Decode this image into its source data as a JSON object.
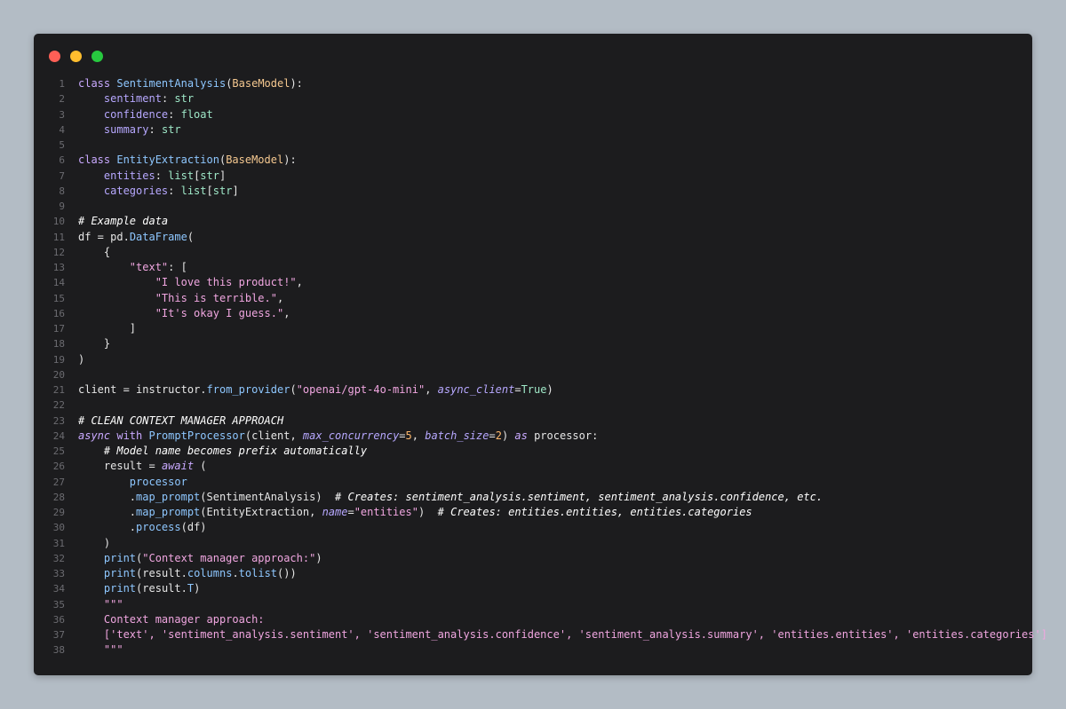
{
  "window": {
    "controls": [
      "close",
      "minimize",
      "maximize"
    ],
    "colors": {
      "background": "#1c1c1e",
      "close": "#ff5f56",
      "minimize": "#ffbd2e",
      "maximize": "#27c93f"
    }
  },
  "code": {
    "lines": [
      {
        "n": "1",
        "text": "class SentimentAnalysis(BaseModel):"
      },
      {
        "n": "2",
        "text": "    sentiment: str"
      },
      {
        "n": "3",
        "text": "    confidence: float"
      },
      {
        "n": "4",
        "text": "    summary: str"
      },
      {
        "n": "5",
        "text": ""
      },
      {
        "n": "6",
        "text": "class EntityExtraction(BaseModel):"
      },
      {
        "n": "7",
        "text": "    entities: list[str]"
      },
      {
        "n": "8",
        "text": "    categories: list[str]"
      },
      {
        "n": "9",
        "text": ""
      },
      {
        "n": "10",
        "text": "# Example data"
      },
      {
        "n": "11",
        "text": "df = pd.DataFrame("
      },
      {
        "n": "12",
        "text": "    {"
      },
      {
        "n": "13",
        "text": "        \"text\": ["
      },
      {
        "n": "14",
        "text": "            \"I love this product!\","
      },
      {
        "n": "15",
        "text": "            \"This is terrible.\","
      },
      {
        "n": "16",
        "text": "            \"It's okay I guess.\","
      },
      {
        "n": "17",
        "text": "        ]"
      },
      {
        "n": "18",
        "text": "    }"
      },
      {
        "n": "19",
        "text": ")"
      },
      {
        "n": "20",
        "text": ""
      },
      {
        "n": "21",
        "text": "client = instructor.from_provider(\"openai/gpt-4o-mini\", async_client=True)"
      },
      {
        "n": "22",
        "text": ""
      },
      {
        "n": "23",
        "text": "# CLEAN CONTEXT MANAGER APPROACH"
      },
      {
        "n": "24",
        "text": "async with PromptProcessor(client, max_concurrency=5, batch_size=2) as processor:"
      },
      {
        "n": "25",
        "text": "    # Model name becomes prefix automatically"
      },
      {
        "n": "26",
        "text": "    result = await ("
      },
      {
        "n": "27",
        "text": "        processor"
      },
      {
        "n": "28",
        "text": "        .map_prompt(SentimentAnalysis)  # Creates: sentiment_analysis.sentiment, sentiment_analysis.confidence, etc."
      },
      {
        "n": "29",
        "text": "        .map_prompt(EntityExtraction, name=\"entities\")  # Creates: entities.entities, entities.categories"
      },
      {
        "n": "30",
        "text": "        .process(df)"
      },
      {
        "n": "31",
        "text": "    )"
      },
      {
        "n": "32",
        "text": "    print(\"Context manager approach:\")"
      },
      {
        "n": "33",
        "text": "    print(result.columns.tolist())"
      },
      {
        "n": "34",
        "text": "    print(result.T)"
      },
      {
        "n": "35",
        "text": "    \"\"\""
      },
      {
        "n": "36",
        "text": "    Context manager approach:"
      },
      {
        "n": "37",
        "text": "    ['text', 'sentiment_analysis.sentiment', 'sentiment_analysis.confidence', 'sentiment_analysis.summary', 'entities.entities', 'entities.categories']"
      },
      {
        "n": "38",
        "text": "    \"\"\""
      }
    ]
  }
}
